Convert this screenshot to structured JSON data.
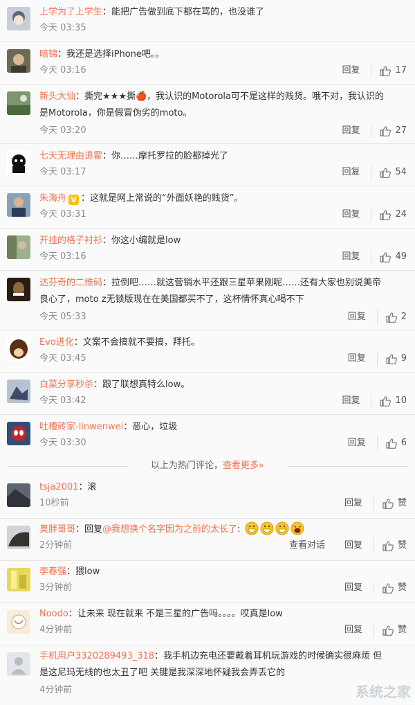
{
  "hot_comments": [
    {
      "user": "上学为了上学生",
      "text": "：能把广告做到底下都在骂的，也没谁了",
      "time": "今天 03:35",
      "reply": "",
      "likes": ""
    },
    {
      "user": "暗锦",
      "text": "：我还是选择iPhone吧。。",
      "time": "今天 03:16",
      "reply": "回复",
      "likes": "17"
    },
    {
      "user": "新头大仙",
      "text": "：撕完★★★撕🍎，我认识的Motorola可不是这样的贱货。哦不对，我认识的",
      "text2": "是Motorola，你是假冒伪劣的moto。",
      "time": "今天 03:20",
      "reply": "回复",
      "likes": "27"
    },
    {
      "user": "七天无理由退霍",
      "text": "：你……摩托罗拉的脸都掉光了",
      "time": "今天 03:17",
      "reply": "回复",
      "likes": "54"
    },
    {
      "user": "朱海舟",
      "badge": "V",
      "text": "：这就是网上常说的“外面妖艳的贱货”。",
      "time": "今天 03:31",
      "reply": "回复",
      "likes": "24"
    },
    {
      "user": "开挂的格子衬衫",
      "text": "：你这小编就是low",
      "time": "今天 03:16",
      "reply": "回复",
      "likes": "49"
    },
    {
      "user": "达芬奇的二维码",
      "text": "：拉倒吧……就这营销水平还跟三星苹果刚呢……还有大家也别说美帝",
      "text2": "良心了，moto z无锁版现在在美国都买不了，这杯情怀真心喝不下",
      "time": "今天 05:33",
      "reply": "回复",
      "likes": "2"
    },
    {
      "user": "Evo进化",
      "text": "：文案不会搞就不要搞，拜托。",
      "time": "今天 03:45",
      "reply": "回复",
      "likes": "9"
    },
    {
      "user": "白菜分享秒杀",
      "text": "：跟了联想真特么low。",
      "time": "今天 03:42",
      "reply": "回复",
      "likes": "10"
    },
    {
      "user": "吐槽砖家-linwenwei",
      "text": "：恶心，垃圾",
      "time": "今天 03:30",
      "reply": "回复",
      "likes": "6"
    }
  ],
  "divider": {
    "text": "以上为热门评论，",
    "more": "查看更多»"
  },
  "new_comments": [
    {
      "user": "tsja2001",
      "text": "：滚",
      "time": "10秒前",
      "reply": "回复",
      "likes": "赞"
    },
    {
      "user": "奥胖哥哥",
      "text": "：回复",
      "mention": "@我想换个名字因为之前的太长了",
      "text_after": ":",
      "time": "2分钟前",
      "view": "查看对话",
      "reply": "回复",
      "likes": "赞"
    },
    {
      "user": "李春强",
      "text": "：猥low",
      "time": "3分钟前",
      "reply": "回复",
      "likes": "赞"
    },
    {
      "user": "Noodo",
      "text": "：让未来 现在就来 不是三星的广告吗。。。。哎真是low",
      "time": "4分钟前",
      "reply": "回复",
      "likes": "赞"
    },
    {
      "user": "手机用户3320289493_318",
      "text": "：我手机边充电还要戴着耳机玩游戏的时候确实很麻烦 但",
      "text2": "是这尼玛无线的也太丑了吧 关键是我深深地怀疑我会弄丢它的",
      "time": "4分钟前",
      "reply": "",
      "likes": ""
    }
  ],
  "watermark": "系统之家",
  "colors": {
    "username": "#eb7350",
    "time": "#8c8c8c",
    "background": "#fafafa"
  }
}
